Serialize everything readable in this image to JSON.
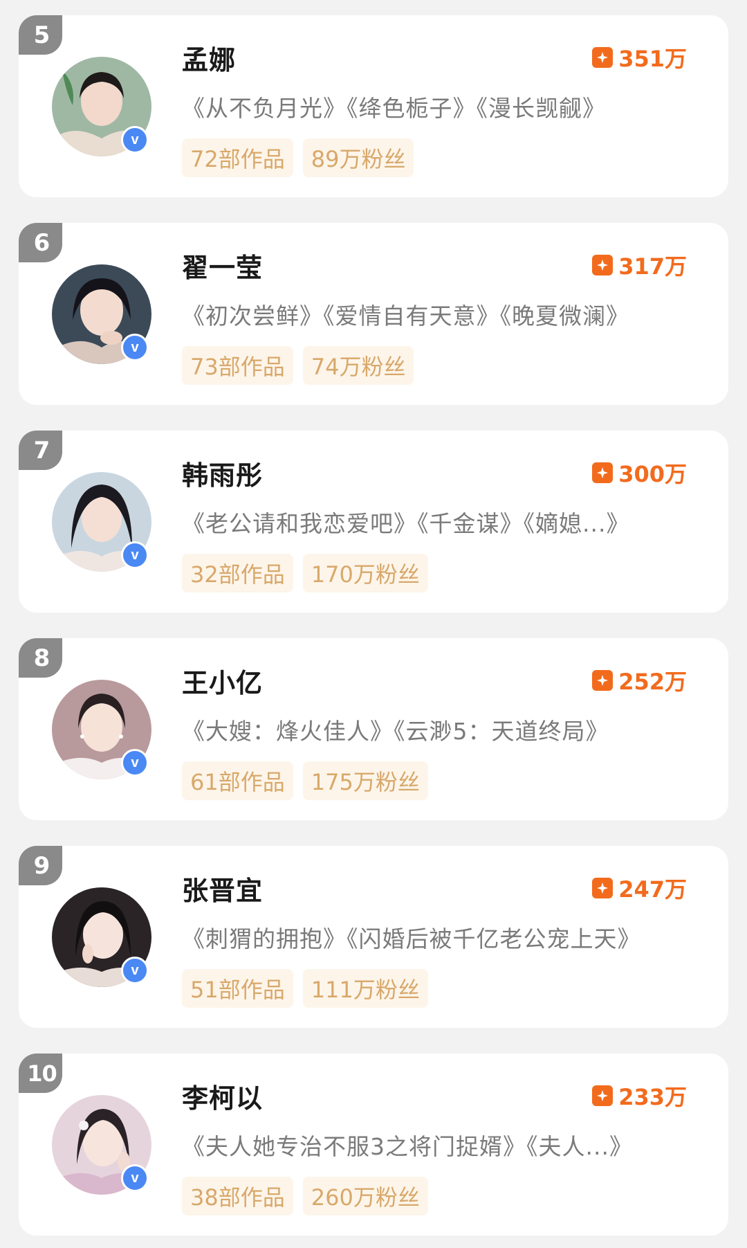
{
  "accent_color": "#f26b1d",
  "rank_badge_color": "#8a8a8a",
  "verified_color": "#4a88f4",
  "tag_text_color": "#d8a86a",
  "heat_icon": "flame-square-icon",
  "verified_icon": "verified-v-icon",
  "entries": [
    {
      "rank": "5",
      "name": "孟娜",
      "heat": "351万",
      "works": "《从不负月光》《绛色栀子》《漫长觊觎》",
      "works_count": "72部作品",
      "fans": "89万粉丝"
    },
    {
      "rank": "6",
      "name": "翟一莹",
      "heat": "317万",
      "works": "《初次尝鲜》《爱情自有天意》《晚夏微澜》",
      "works_count": "73部作品",
      "fans": "74万粉丝"
    },
    {
      "rank": "7",
      "name": "韩雨彤",
      "heat": "300万",
      "works": "《老公请和我恋爱吧》《千金谋》《嫡媳...》",
      "works_count": "32部作品",
      "fans": "170万粉丝"
    },
    {
      "rank": "8",
      "name": "王小亿",
      "heat": "252万",
      "works": "《大嫂：烽火佳人》《云渺5：天道终局》",
      "works_count": "61部作品",
      "fans": "175万粉丝"
    },
    {
      "rank": "9",
      "name": "张晋宜",
      "heat": "247万",
      "works": "《刺猬的拥抱》《闪婚后被千亿老公宠上天》",
      "works_count": "51部作品",
      "fans": "111万粉丝"
    },
    {
      "rank": "10",
      "name": "李柯以",
      "heat": "233万",
      "works": "《夫人她专治不服3之将门捉婿》《夫人...》",
      "works_count": "38部作品",
      "fans": "260万粉丝"
    }
  ]
}
